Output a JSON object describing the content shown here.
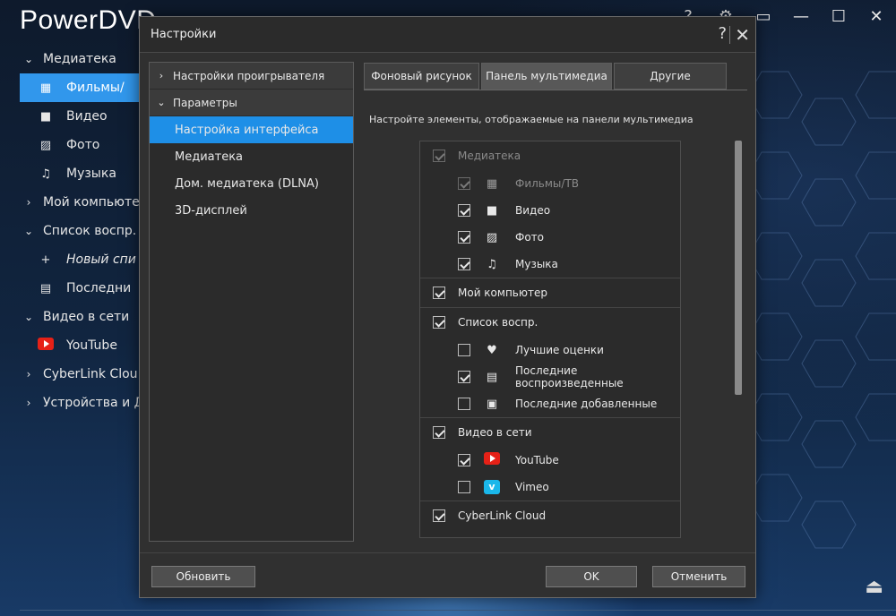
{
  "app": {
    "title": "PowerDVD",
    "window_controls": [
      "?",
      "⚙",
      "📺",
      "—",
      "☐",
      "✕"
    ],
    "sidebar": [
      {
        "label": "Медиатека",
        "type": "group",
        "expanded": true,
        "icon": "chevron-down"
      },
      {
        "label": "Фильмы/",
        "type": "sub",
        "icon": "film-icon",
        "selected": true
      },
      {
        "label": "Видео",
        "type": "sub",
        "icon": "video-icon"
      },
      {
        "label": "Фото",
        "type": "sub",
        "icon": "photo-icon"
      },
      {
        "label": "Музыка",
        "type": "sub",
        "icon": "music-icon"
      },
      {
        "label": "Мой компьюте",
        "type": "group",
        "expanded": false
      },
      {
        "label": "Список воспр.",
        "type": "group",
        "expanded": true
      },
      {
        "label": "Новый спи",
        "type": "sub",
        "icon": "plus-icon",
        "italic": true
      },
      {
        "label": "Последни",
        "type": "sub",
        "icon": "recent-icon"
      },
      {
        "label": "Видео в сети",
        "type": "group",
        "expanded": true
      },
      {
        "label": "YouTube",
        "type": "sub",
        "icon": "youtube-icon"
      },
      {
        "label": "CyberLink Clou",
        "type": "group",
        "expanded": false
      },
      {
        "label": "Устройства и Д",
        "type": "group",
        "expanded": false
      }
    ]
  },
  "dialog": {
    "title": "Настройки",
    "help": "?",
    "close": "✕",
    "tree": {
      "player_settings": "Настройки проигрывателя",
      "parameters": "Параметры",
      "items": [
        "Настройка интерфейса",
        "Медиатека",
        "Дом. медиатека (DLNA)",
        "3D-дисплей"
      ],
      "selected_index": 0
    },
    "tabs": [
      "Фоновый рисунок",
      "Панель мультимедиа",
      "Другие"
    ],
    "active_tab": 1,
    "description": "Настройте элементы, отображаемые на панели мультимедиа",
    "groups": [
      {
        "label": "Медиатека",
        "checked": true,
        "disabled": true,
        "children": [
          {
            "label": "Фильмы/ТВ",
            "checked": true,
            "disabled": true,
            "icon": "film-icon"
          },
          {
            "label": "Видео",
            "checked": true,
            "icon": "video-icon"
          },
          {
            "label": "Фото",
            "checked": true,
            "icon": "photo-icon"
          },
          {
            "label": "Музыка",
            "checked": true,
            "icon": "music-icon"
          }
        ]
      },
      {
        "label": "Мой компьютер",
        "checked": true,
        "children": []
      },
      {
        "label": "Список воспр.",
        "checked": true,
        "children": [
          {
            "label": "Лучшие оценки",
            "checked": false,
            "icon": "heart-icon"
          },
          {
            "label": "Последние воспроизведенные",
            "checked": true,
            "icon": "recent-played-icon"
          },
          {
            "label": "Последние добавленные",
            "checked": false,
            "icon": "recent-added-icon"
          }
        ]
      },
      {
        "label": "Видео в сети",
        "checked": true,
        "children": [
          {
            "label": "YouTube",
            "checked": true,
            "icon": "youtube-icon"
          },
          {
            "label": "Vimeo",
            "checked": false,
            "icon": "vimeo-icon"
          }
        ]
      }
    ],
    "cut_row_label": "CyberLink Cloud",
    "buttons": {
      "refresh": "Обновить",
      "ok": "OK",
      "cancel": "Отменить"
    }
  }
}
